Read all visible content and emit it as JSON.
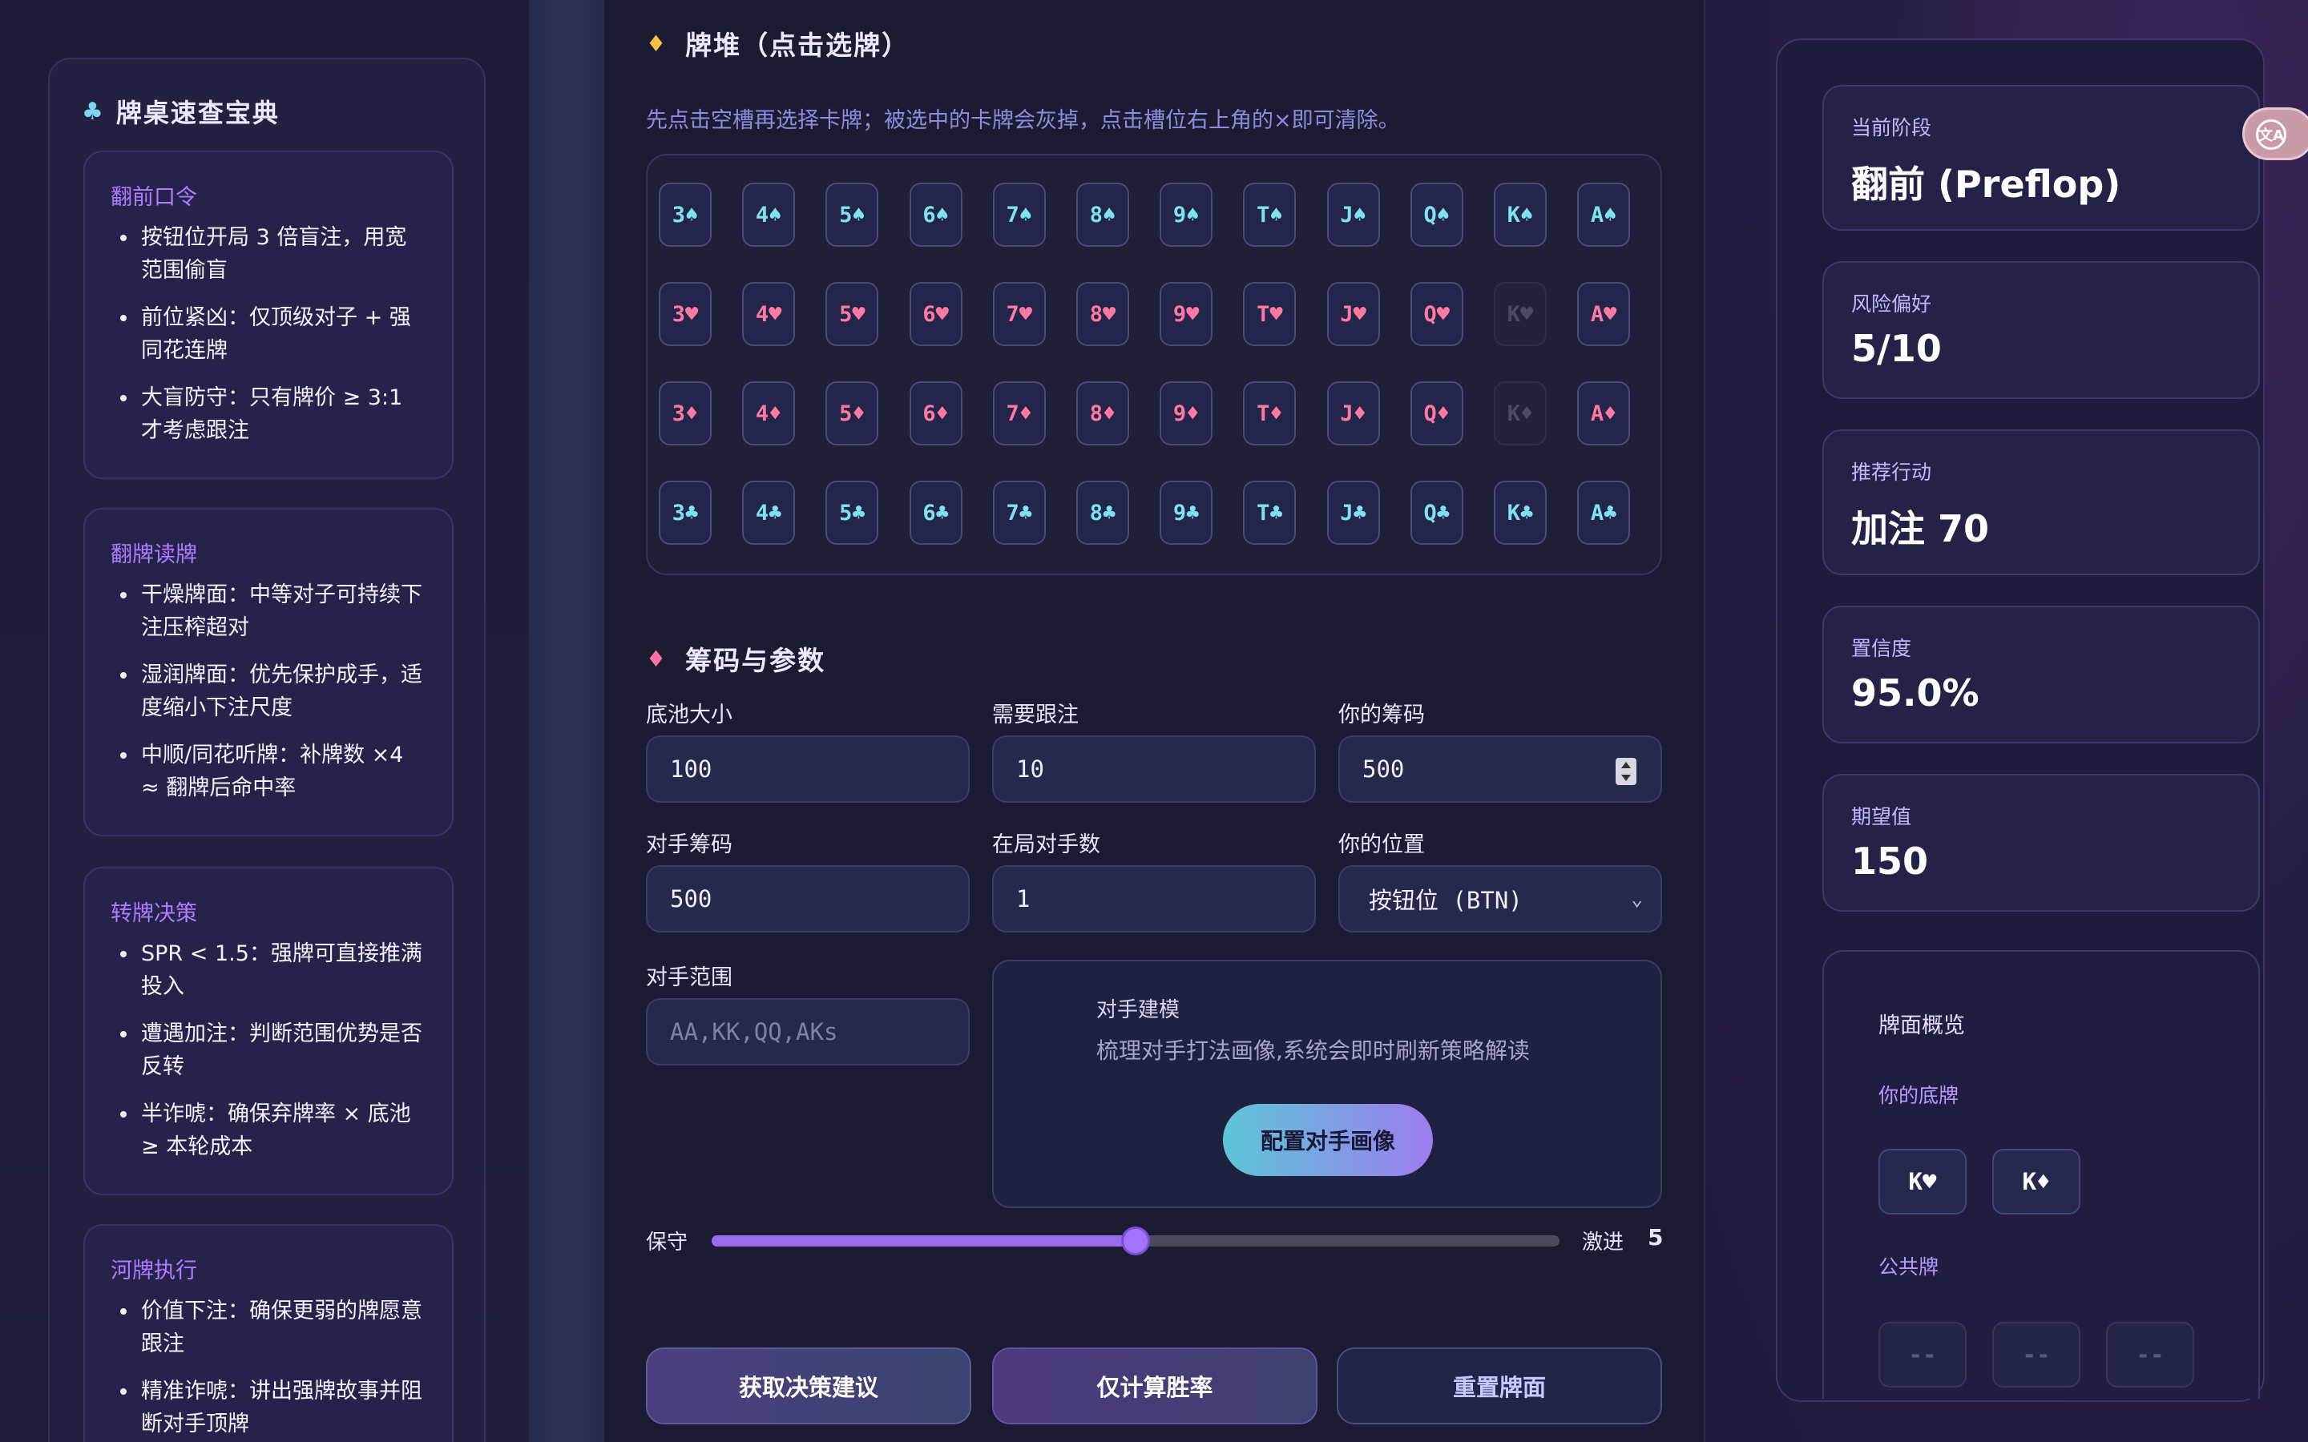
{
  "left": {
    "title": "牌桌速查宝典",
    "sections": [
      {
        "title": "翻前口令",
        "items": [
          "按钮位开局 3 倍盲注，用宽范围偷盲",
          "前位紧凶：仅顶级对子 + 强同花连牌",
          "大盲防守：只有牌价 ≥ 3:1 才考虑跟注"
        ]
      },
      {
        "title": "翻牌读牌",
        "items": [
          "干燥牌面：中等对子可持续下注压榨超对",
          "湿润牌面：优先保护成手，适度缩小下注尺度",
          "中顺/同花听牌：补牌数 ×4 ≈ 翻牌后命中率"
        ]
      },
      {
        "title": "转牌决策",
        "items": [
          "SPR < 1.5：强牌可直接推满投入",
          "遭遇加注：判断范围优势是否反转",
          "半诈唬：确保弃牌率 × 底池 ≥ 本轮成本"
        ]
      },
      {
        "title": "河牌执行",
        "items": [
          "价值下注：确保更弱的牌愿意跟注",
          "精准诈唬：讲出强牌故事并阻断对手顶牌"
        ]
      }
    ]
  },
  "deck": {
    "title": "牌堆（点击选牌）",
    "hint": "先点击空槽再选择卡牌；被选中的卡牌会灰掉，点击槽位右上角的×即可清除。",
    "ranks": [
      "3",
      "4",
      "5",
      "6",
      "7",
      "8",
      "9",
      "T",
      "J",
      "Q",
      "K",
      "A"
    ],
    "suits": [
      {
        "symbol": "♠",
        "name": "spade"
      },
      {
        "symbol": "♥",
        "name": "heart"
      },
      {
        "symbol": "♦",
        "name": "diamond"
      },
      {
        "symbol": "♣",
        "name": "club"
      }
    ],
    "used": [
      "K♥",
      "K♦"
    ]
  },
  "params": {
    "title": "筹码与参数",
    "pot_label": "底池大小",
    "pot_value": "100",
    "call_label": "需要跟注",
    "call_value": "10",
    "stack_label": "你的筹码",
    "stack_value": "500",
    "opp_stack_label": "对手筹码",
    "opp_stack_value": "500",
    "opponents_label": "在局对手数",
    "opponents_value": "1",
    "position_label": "你的位置",
    "position_value": "按钮位 (BTN)",
    "range_label": "对手范围",
    "range_placeholder": "AA,KK,QQ,AKs",
    "model_title": "对手建模",
    "model_desc": "梳理对手打法画像,系统会即时刷新策略解读",
    "model_button": "配置对手画像",
    "risk_low": "保守",
    "risk_high": "激进",
    "risk_value": "5",
    "risk_fraction": 0.5
  },
  "actions": {
    "advice": "获取决策建议",
    "equity": "仅计算胜率",
    "reset": "重置牌面"
  },
  "stats": [
    {
      "label": "当前阶段",
      "value": "翻前 (Preflop)"
    },
    {
      "label": "风险偏好",
      "value": "5/10"
    },
    {
      "label": "推荐行动",
      "value": "加注 70"
    },
    {
      "label": "置信度",
      "value": "95.0%"
    },
    {
      "label": "期望值",
      "value": "150"
    }
  ],
  "overview": {
    "title": "牌面概览",
    "hole_label": "你的底牌",
    "hole_cards": [
      "K♥",
      "K♦"
    ],
    "board_label": "公共牌",
    "board_cards": [
      "--",
      "--",
      "--"
    ]
  },
  "translate_icon": "translate-icon",
  "colors": {
    "accent": "#a173ff",
    "spade_club": "#7ee3f0",
    "heart_diamond": "#ff7aa0"
  }
}
